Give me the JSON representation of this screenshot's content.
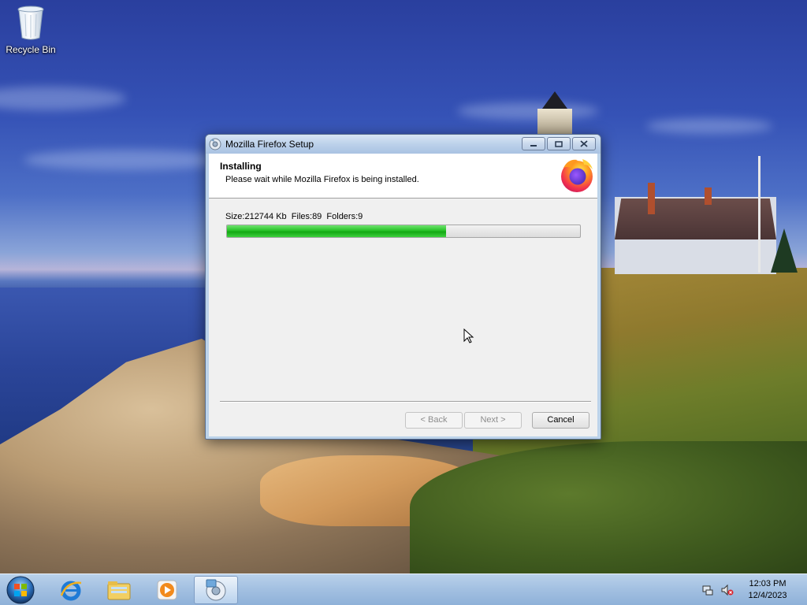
{
  "desktop": {
    "icons": [
      {
        "label": "Recycle Bin"
      }
    ]
  },
  "window": {
    "title": "Mozilla Firefox Setup",
    "header_title": "Installing",
    "header_subtitle": "Please wait while Mozilla Firefox is being installed.",
    "status_text": "Size:212744 Kb  Files:89  Folders:9",
    "progress_fraction": 0.62,
    "buttons": {
      "back": "< Back",
      "next": "Next >",
      "cancel": "Cancel"
    }
  },
  "taskbar": {
    "pinned": [
      "start-orb-icon",
      "internet-explorer-icon",
      "file-explorer-icon",
      "media-player-icon",
      "firefox-setup-icon"
    ],
    "clock_time": "12:03 PM",
    "clock_date": "12/4/2023"
  },
  "colors": {
    "progress_green": "#1db81d",
    "titlebar": "#bcd1ea"
  }
}
